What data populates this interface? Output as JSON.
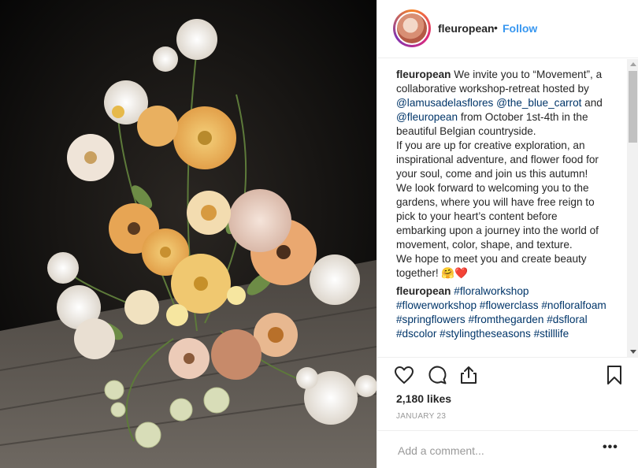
{
  "post": {
    "username": "fleuropean",
    "separator": "•",
    "follow_label": "Follow"
  },
  "caption": {
    "username": "fleuropean",
    "line1": " We invite you to “Movement”, a collaborative workshop-retreat hosted by ",
    "mention1": "@lamusadelasflores",
    "space1": " ",
    "mention2": "@the_blue_carrot",
    "and": " and ",
    "mention3": "@fleuropean",
    "line2": " from October 1st-4th in the beautiful Belgian countryside.",
    "para2": "If you are up for creative exploration, an inspirational adventure, and flower food for your soul, come and join us this autumn!",
    "para3": "We look forward to welcoming you to the gardens, where you will have free reign to pick to your heart’s content before embarking upon a journey into the world of movement, color, shape, and texture.",
    "para4": "We hope to meet you and create beauty together! 🤗❤️"
  },
  "hashtag_comment": {
    "username": "fleuropean",
    "tags": [
      "#floralworkshop",
      "#flowerworkshop",
      "#flowerclass",
      "#nofloralfoam",
      "#springflowers",
      "#fromthegarden",
      "#dsfloral",
      "#dscolor",
      "#stylingtheseasons",
      "#stilllife"
    ]
  },
  "actions": {
    "icons": [
      "heart-icon",
      "comment-icon",
      "share-icon",
      "bookmark-icon"
    ]
  },
  "likes_text": "2,180 likes",
  "date_text": "JANUARY 23",
  "comment": {
    "placeholder": "Add a comment...",
    "more_label": "•••"
  },
  "colors": {
    "link": "#003569",
    "follow": "#3897f0",
    "text": "#262626",
    "muted": "#999999"
  }
}
